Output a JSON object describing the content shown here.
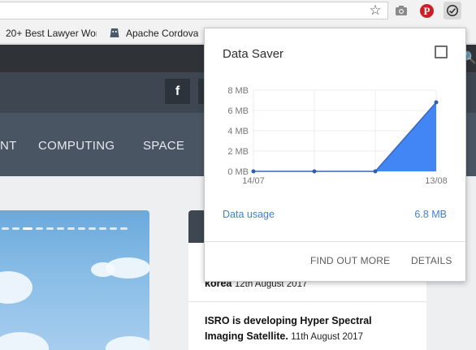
{
  "toolbar": {
    "icons": [
      "star-icon",
      "camera-icon",
      "pinterest-icon",
      "data-saver-icon"
    ]
  },
  "bookmarks": {
    "items": [
      {
        "label": "20+ Best Lawyer Wor"
      },
      {
        "label": "Apache Cordova",
        "icon": "cordova-icon"
      },
      {
        "label": "",
        "icon": "bookmark-icon"
      }
    ]
  },
  "site": {
    "nav": [
      "NT",
      "COMPUTING",
      "SPACE"
    ],
    "social": {
      "facebook_label": "f"
    },
    "news": [
      {
        "title": "korea",
        "date": "12th August 2017"
      },
      {
        "title_line1": "ISRO is developing Hyper Spectral",
        "title_line2": "Imaging Satellite.",
        "date": "11th August 2017"
      }
    ]
  },
  "popup": {
    "title": "Data Saver",
    "usage_label": "Data usage",
    "usage_value": "6.8 MB",
    "find_out_more": "FIND OUT MORE",
    "details": "DETAILS",
    "colors": {
      "accent": "#4285f4",
      "link": "#3f7fd8"
    }
  },
  "chart_data": {
    "type": "area",
    "y_ticks": [
      "0 MB",
      "2 MB",
      "4 MB",
      "6 MB",
      "8 MB"
    ],
    "x_ticks": [
      "14/07",
      "13/08"
    ],
    "ylim": [
      0,
      8
    ],
    "x": [
      0,
      10,
      20,
      30
    ],
    "values": [
      0,
      0,
      0,
      6.8
    ],
    "grid": true,
    "color": "#4285f4"
  }
}
